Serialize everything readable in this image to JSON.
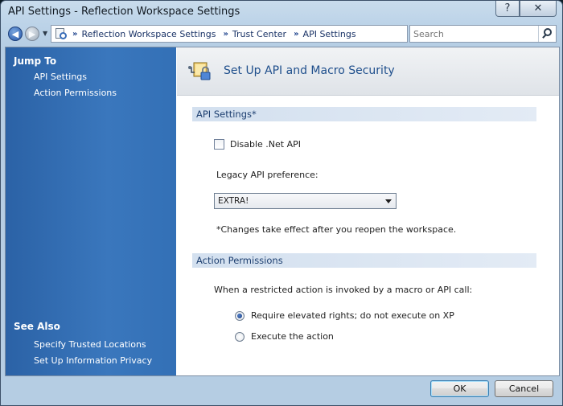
{
  "window": {
    "title": "API Settings - Reflection Workspace Settings",
    "help_glyph": "?",
    "close_glyph": "✕"
  },
  "navigation": {
    "breadcrumbs": [
      "Reflection Workspace Settings",
      "Trust Center",
      "API Settings"
    ],
    "separator": "»",
    "search_placeholder": "Search"
  },
  "sidebar": {
    "jump_to_heading": "Jump To",
    "jump_to_links": [
      "API Settings",
      "Action Permissions"
    ],
    "see_also_heading": "See Also",
    "see_also_links": [
      "Specify Trusted Locations",
      "Set Up Information Privacy"
    ]
  },
  "page": {
    "title": "Set Up API and Macro Security",
    "api_section": {
      "heading": "API Settings*",
      "disable_net_api_label": "Disable .Net API",
      "disable_net_api_checked": false,
      "legacy_label": "Legacy API preference:",
      "legacy_value": "EXTRA!",
      "note": "*Changes take effect after you reopen the workspace."
    },
    "action_section": {
      "heading": "Action Permissions",
      "prompt": "When a restricted action is invoked by a macro or API call:",
      "options": [
        {
          "label": "Require elevated rights; do not execute on XP",
          "selected": true
        },
        {
          "label": "Execute the action",
          "selected": false
        }
      ]
    }
  },
  "buttons": {
    "ok": "OK",
    "cancel": "Cancel"
  }
}
